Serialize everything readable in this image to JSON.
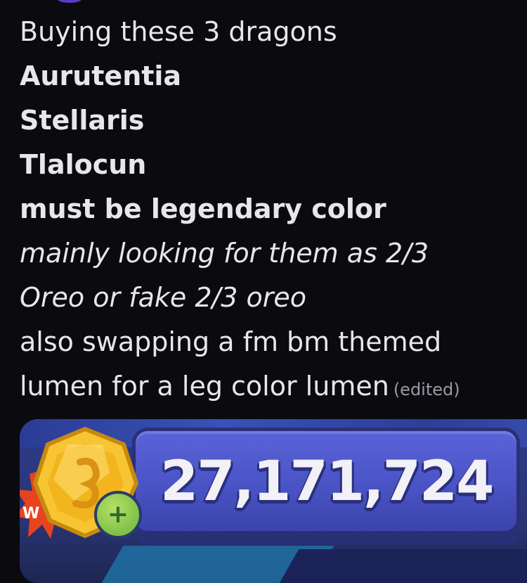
{
  "message": {
    "intro": "Buying these 3 dragons",
    "dragons": [
      "Aurutentia",
      "Stellaris",
      "Tlalocun"
    ],
    "requirement": "must be legendary color",
    "italic_lines": [
      "mainly looking for them as 2/3",
      "Oreo or fake 2/3 oreo"
    ],
    "swap_lines": [
      "also swapping a fm bm themed",
      "lumen for a leg color lumen"
    ],
    "edited_tag": "(edited)"
  },
  "attachment": {
    "coin_count": "27,171,724",
    "badge_letter": "W",
    "plus_symbol": "+",
    "icons": [
      "gold-coin-icon",
      "plus-circle-icon",
      "red-burst-icon"
    ]
  },
  "colors": {
    "background": "#0b0a0f",
    "text": "#e7e7ea",
    "edited": "#9a9aa2",
    "bar_fill": "#4b55c7",
    "coin": "#f2b51e",
    "plus": "#7fc14a"
  }
}
